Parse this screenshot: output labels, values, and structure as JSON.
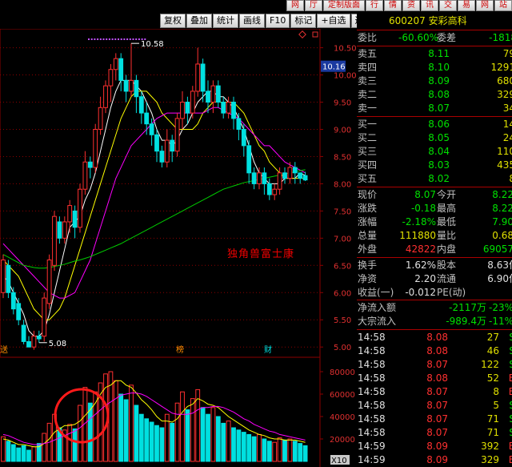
{
  "menu": [
    "网",
    "厅",
    "定制版面",
    "行",
    "情",
    "资",
    "讯",
    "交",
    "易",
    "网",
    "站"
  ],
  "toolbar": [
    "复权",
    "叠加",
    "统计",
    "画线",
    "F10",
    "标记",
    "+自选",
    "返回"
  ],
  "chart": {
    "price_ticks": [
      "10.50",
      "10.00",
      "9.50",
      "9.00",
      "8.50",
      "8.00",
      "7.50",
      "7.00",
      "6.50",
      "6.00",
      "5.50",
      "5.00"
    ],
    "current_price": "10.16",
    "high_label": "10.58",
    "low_label": "5.08",
    "marker_left": "送",
    "marker_mid": "榜",
    "marker_right": "财",
    "volume_ticks": [
      "80000",
      "60000",
      "40000",
      "20000"
    ],
    "volume_unit": "X10",
    "watermark": "独角兽富士康",
    "colors": {
      "up": "#ff3030",
      "down": "#00e0e0",
      "ma5": "#ffffff",
      "ma10": "#ffff00",
      "ma20": "#ff00ff",
      "ma60": "#00cc00",
      "grid": "#8b0000"
    }
  },
  "chart_data": {
    "type": "candlestick",
    "y_range": [
      4.9,
      10.7
    ],
    "volume_range": [
      0,
      90000
    ],
    "candles": [
      [
        6.0,
        6.6,
        5.9,
        6.7
      ],
      [
        6.5,
        6.0,
        5.9,
        6.6
      ],
      [
        6.0,
        5.7,
        5.6,
        6.1
      ],
      [
        5.8,
        5.5,
        5.4,
        5.9
      ],
      [
        5.4,
        5.1,
        5.05,
        5.5
      ],
      [
        5.1,
        5.0,
        5.0,
        5.2
      ],
      [
        5.0,
        5.2,
        4.95,
        5.3
      ],
      [
        5.2,
        5.15,
        5.08,
        5.3
      ],
      [
        5.2,
        5.9,
        5.1,
        6.0
      ],
      [
        5.8,
        6.6,
        5.7,
        6.7
      ],
      [
        6.5,
        7.4,
        6.4,
        7.5
      ],
      [
        7.3,
        7.0,
        6.9,
        7.4
      ],
      [
        7.0,
        7.3,
        6.9,
        7.4
      ],
      [
        7.3,
        7.6,
        7.1,
        7.7
      ],
      [
        7.5,
        7.2,
        7.0,
        7.6
      ],
      [
        7.2,
        7.9,
        7.1,
        8.0
      ],
      [
        7.9,
        8.4,
        7.8,
        8.6
      ],
      [
        8.4,
        8.3,
        8.1,
        8.5
      ],
      [
        8.3,
        9.0,
        8.2,
        9.1
      ],
      [
        9.0,
        9.4,
        8.9,
        9.6
      ],
      [
        9.4,
        9.8,
        9.3,
        9.9
      ],
      [
        9.8,
        10.1,
        9.5,
        10.2
      ],
      [
        10.1,
        10.3,
        9.9,
        10.4
      ],
      [
        10.3,
        9.9,
        9.7,
        10.4
      ],
      [
        9.9,
        9.7,
        9.5,
        10.0
      ],
      [
        9.7,
        9.9,
        9.6,
        10.58
      ],
      [
        9.9,
        9.6,
        9.3,
        10.0
      ],
      [
        9.6,
        9.3,
        9.1,
        9.7
      ],
      [
        9.3,
        9.1,
        8.9,
        9.5
      ],
      [
        9.1,
        8.9,
        8.7,
        9.2
      ],
      [
        8.9,
        8.6,
        8.4,
        9.0
      ],
      [
        8.6,
        8.4,
        8.3,
        8.7
      ],
      [
        8.4,
        8.8,
        8.3,
        9.0
      ],
      [
        8.8,
        8.6,
        8.4,
        8.9
      ],
      [
        8.6,
        9.2,
        8.5,
        9.3
      ],
      [
        9.2,
        9.5,
        9.0,
        9.7
      ],
      [
        9.5,
        9.3,
        9.1,
        9.6
      ],
      [
        9.3,
        9.7,
        9.2,
        9.8
      ],
      [
        9.7,
        10.2,
        9.6,
        10.5
      ],
      [
        10.2,
        9.7,
        9.5,
        10.3
      ],
      [
        9.7,
        9.5,
        9.3,
        9.9
      ],
      [
        9.5,
        9.8,
        9.3,
        9.9
      ],
      [
        9.8,
        9.5,
        9.4,
        9.9
      ],
      [
        9.5,
        9.3,
        9.2,
        9.6
      ],
      [
        9.3,
        9.5,
        9.2,
        9.6
      ],
      [
        9.5,
        9.2,
        9.0,
        9.6
      ],
      [
        9.2,
        9.0,
        8.8,
        9.3
      ],
      [
        9.0,
        8.7,
        8.5,
        9.1
      ],
      [
        8.7,
        8.2,
        8.0,
        8.8
      ],
      [
        8.2,
        8.0,
        7.9,
        8.3
      ],
      [
        8.0,
        8.2,
        7.9,
        8.3
      ],
      [
        8.2,
        8.0,
        7.8,
        8.3
      ],
      [
        8.0,
        7.8,
        7.7,
        8.1
      ],
      [
        7.8,
        7.9,
        7.7,
        8.0
      ],
      [
        7.9,
        8.2,
        7.8,
        8.3
      ],
      [
        8.2,
        8.1,
        8.0,
        8.3
      ],
      [
        8.1,
        8.3,
        8.0,
        8.4
      ],
      [
        8.3,
        8.2,
        8.0,
        8.4
      ],
      [
        8.2,
        8.1,
        8.0,
        8.2
      ],
      [
        8.15,
        8.07,
        8.05,
        8.22
      ]
    ],
    "volume": [
      22000,
      18000,
      15000,
      12000,
      14000,
      10000,
      13000,
      16000,
      25000,
      34000,
      42000,
      30000,
      28000,
      33000,
      29000,
      50000,
      66000,
      52000,
      62000,
      70000,
      78000,
      80000,
      72000,
      60000,
      55000,
      68000,
      50000,
      42000,
      38000,
      35000,
      32000,
      30000,
      42000,
      34000,
      52000,
      62000,
      46000,
      56000,
      64000,
      48000,
      42000,
      48000,
      40000,
      34000,
      36000,
      30000,
      28000,
      26000,
      24000,
      22000,
      24000,
      20000,
      18000,
      17000,
      21000,
      19000,
      20000,
      18000,
      16000,
      14000
    ],
    "ma": [
      {
        "name": "MA5",
        "values": [
          6.3,
          6.2,
          6.0,
          5.8,
          5.6,
          5.3,
          5.2,
          5.2,
          5.3,
          5.6,
          6.0,
          6.4,
          6.8,
          7.2,
          7.3,
          7.4,
          7.7,
          7.9,
          8.2,
          8.6,
          9.0,
          9.4,
          9.7,
          9.9,
          9.9,
          9.9,
          9.8,
          9.7,
          9.5,
          9.3,
          9.0,
          8.8,
          8.8,
          8.7,
          8.8,
          9.0,
          9.1,
          9.3,
          9.5,
          9.6,
          9.7,
          9.7,
          9.6,
          9.6,
          9.5,
          9.4,
          9.2,
          9.0,
          8.7,
          8.4,
          8.2,
          8.1,
          8.0,
          8.0,
          8.0,
          8.1,
          8.1,
          8.1,
          8.2,
          8.15
        ]
      },
      {
        "name": "MA10",
        "values": [
          6.6,
          6.5,
          6.4,
          6.3,
          6.1,
          5.9,
          5.7,
          5.6,
          5.5,
          5.5,
          5.6,
          5.7,
          5.9,
          6.2,
          6.5,
          6.8,
          7.1,
          7.4,
          7.7,
          8.0,
          8.3,
          8.6,
          8.9,
          9.2,
          9.4,
          9.6,
          9.7,
          9.7,
          9.7,
          9.6,
          9.5,
          9.3,
          9.2,
          9.1,
          9.0,
          9.0,
          9.0,
          9.0,
          9.1,
          9.3,
          9.4,
          9.5,
          9.5,
          9.5,
          9.5,
          9.5,
          9.4,
          9.3,
          9.1,
          8.9,
          8.7,
          8.6,
          8.4,
          8.3,
          8.2,
          8.1,
          8.1,
          8.1,
          8.1,
          8.1
        ]
      },
      {
        "name": "MA20",
        "values": [
          6.9,
          6.8,
          6.7,
          6.6,
          6.5,
          6.4,
          6.3,
          6.2,
          6.1,
          6.0,
          5.95,
          5.9,
          5.9,
          5.95,
          6.0,
          6.2,
          6.4,
          6.6,
          6.9,
          7.2,
          7.5,
          7.8,
          8.1,
          8.3,
          8.5,
          8.7,
          8.8,
          8.9,
          9.0,
          9.1,
          9.2,
          9.25,
          9.3,
          9.3,
          9.3,
          9.3,
          9.3,
          9.3,
          9.3,
          9.3,
          9.35,
          9.4,
          9.4,
          9.35,
          9.3,
          9.25,
          9.2,
          9.1,
          9.0,
          8.9,
          8.8,
          8.7,
          8.7,
          8.6,
          8.5,
          8.4,
          8.35,
          8.3,
          8.25,
          8.2
        ]
      },
      {
        "name": "MA60",
        "values": [
          6.7,
          6.65,
          6.6,
          6.55,
          6.5,
          6.48,
          6.46,
          6.45,
          6.45,
          6.46,
          6.48,
          6.5,
          6.52,
          6.55,
          6.58,
          6.6,
          6.63,
          6.66,
          6.7,
          6.74,
          6.78,
          6.82,
          6.86,
          6.9,
          6.95,
          7.0,
          7.05,
          7.1,
          7.15,
          7.2,
          7.25,
          7.3,
          7.35,
          7.4,
          7.45,
          7.5,
          7.55,
          7.6,
          7.65,
          7.7,
          7.75,
          7.8,
          7.85,
          7.9,
          7.93,
          7.96,
          7.99,
          8.02,
          8.04,
          8.06,
          8.08,
          8.1,
          8.12,
          8.14,
          8.16,
          8.18,
          8.2,
          8.22,
          8.24,
          8.26
        ]
      },
      {
        "name": "VMA5",
        "values": [
          20000,
          19000,
          17000,
          15000,
          15000,
          14000,
          13000,
          13000,
          16000,
          20000,
          26000,
          29000,
          32000,
          32000,
          33000,
          36000,
          41000,
          46000,
          52000,
          60000,
          66000,
          68000,
          72000,
          72000,
          68000,
          66000,
          61000,
          55000,
          51000,
          46000,
          40000,
          36000,
          36000,
          35000,
          38000,
          44000,
          49000,
          51000,
          56000,
          54000,
          51000,
          50000,
          48000,
          44000,
          40000,
          37000,
          34000,
          31000,
          28000,
          26000,
          24000,
          23000,
          21000,
          20000,
          20000,
          19000,
          19000,
          19000,
          18000,
          17000
        ]
      },
      {
        "name": "VMA10",
        "values": [
          24000,
          23000,
          21000,
          19000,
          17000,
          16000,
          15000,
          15000,
          16000,
          17000,
          19000,
          21000,
          23000,
          25000,
          27000,
          30000,
          34000,
          38000,
          42000,
          46000,
          50000,
          53000,
          56000,
          59000,
          60000,
          61000,
          61000,
          60000,
          58000,
          55000,
          52000,
          49000,
          46000,
          43000,
          42000,
          42000,
          42000,
          43000,
          46000,
          48000,
          48000,
          49000,
          49000,
          48000,
          46000,
          44000,
          41000,
          38000,
          36000,
          33000,
          31000,
          29000,
          27000,
          26000,
          24000,
          23000,
          22000,
          21000,
          20000,
          19000
        ]
      }
    ]
  },
  "panel": {
    "title": "600207 安彩高科",
    "ratio": {
      "label1": "委比",
      "value1": "-60.60%",
      "label2": "委差",
      "value2": "-1818"
    },
    "asks": [
      {
        "label": "卖五",
        "price": "8.11",
        "vol": "79"
      },
      {
        "label": "卖四",
        "price": "8.10",
        "vol": "1291"
      },
      {
        "label": "卖三",
        "price": "8.09",
        "vol": "680"
      },
      {
        "label": "卖二",
        "price": "8.08",
        "vol": "329"
      },
      {
        "label": "卖一",
        "price": "8.07",
        "vol": "34"
      }
    ],
    "bids": [
      {
        "label": "买一",
        "price": "8.06",
        "vol": "14"
      },
      {
        "label": "买二",
        "price": "8.05",
        "vol": "24"
      },
      {
        "label": "买三",
        "price": "8.04",
        "vol": "110"
      },
      {
        "label": "买四",
        "price": "8.03",
        "vol": "435"
      },
      {
        "label": "买五",
        "price": "8.02",
        "vol": "8"
      }
    ],
    "stats": [
      {
        "l1": "现价",
        "v1": "8.07",
        "l2": "今开",
        "v2": "8.22",
        "c1": "#00e000",
        "c2": "#00e000"
      },
      {
        "l1": "涨跌",
        "v1": "-0.18",
        "l2": "最高",
        "v2": "8.22",
        "c1": "#00e000",
        "c2": "#00e000"
      },
      {
        "l1": "涨幅",
        "v1": "-2.18%",
        "l2": "最低",
        "v2": "7.90",
        "c1": "#00e000",
        "c2": "#00e000"
      },
      {
        "l1": "总量",
        "v1": "111880",
        "l2": "量比",
        "v2": "0.68",
        "c1": "#e0e000",
        "c2": "#e0e000"
      },
      {
        "l1": "外盘",
        "v1": "42822",
        "l2": "内盘",
        "v2": "69057",
        "c1": "#ff3030",
        "c2": "#00e000"
      }
    ],
    "stats2": [
      {
        "l1": "换手",
        "v1": "1.62%",
        "l2": "股本",
        "v2": "8.63亿"
      },
      {
        "l1": "净资",
        "v1": "2.20",
        "l2": "流通",
        "v2": "6.90亿"
      },
      {
        "l1": "收益(一)",
        "v1": "-0.012",
        "l2": "PE(动)",
        "v2": ""
      }
    ],
    "flows": [
      {
        "label": "净流入额",
        "value": "-2117万",
        "pct": "-23%"
      },
      {
        "label": "大宗流入",
        "value": "-989.4万",
        "pct": "-11%"
      }
    ],
    "ticks": [
      {
        "time": "14:58",
        "price": "8.08",
        "vol": "27",
        "flag": "S",
        "c": "#ff3030",
        "fc": "#00e000"
      },
      {
        "time": "14:58",
        "price": "8.08",
        "vol": "46",
        "flag": "S",
        "c": "#ff3030",
        "fc": "#00e000"
      },
      {
        "time": "14:58",
        "price": "8.07",
        "vol": "122",
        "flag": "S",
        "c": "#ff3030",
        "fc": "#00e000"
      },
      {
        "time": "14:58",
        "price": "8.08",
        "vol": "52",
        "flag": "B",
        "c": "#ff3030",
        "fc": "#ff3030"
      },
      {
        "time": "14:58",
        "price": "8.07",
        "vol": "8",
        "flag": "B",
        "c": "#ff3030",
        "fc": "#ff3030"
      },
      {
        "time": "14:58",
        "price": "8.07",
        "vol": "5",
        "flag": "S",
        "c": "#ff3030",
        "fc": "#00e000"
      },
      {
        "time": "14:58",
        "price": "8.07",
        "vol": "71",
        "flag": "S",
        "c": "#ff3030",
        "fc": "#00e000"
      },
      {
        "time": "14:58",
        "price": "8.07",
        "vol": "71",
        "flag": "S",
        "c": "#ff3030",
        "fc": "#00e000"
      },
      {
        "time": "14:59",
        "price": "8.09",
        "vol": "392",
        "flag": "B",
        "c": "#ff3030",
        "fc": "#ff3030"
      },
      {
        "time": "14:59",
        "price": "8.09",
        "vol": "329",
        "flag": "B",
        "c": "#ff3030",
        "fc": "#ff3030"
      },
      {
        "time": "14:59",
        "price": "8.08",
        "vol": "1",
        "flag": "B",
        "c": "#ff3030",
        "fc": "#ff3030"
      }
    ]
  }
}
